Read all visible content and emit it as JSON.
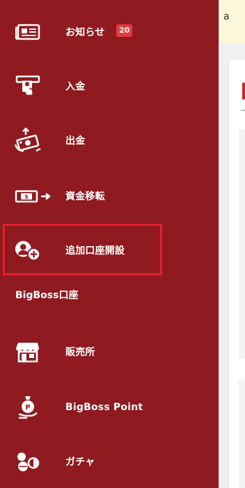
{
  "sidebar": {
    "items": [
      {
        "label": "お知らせ",
        "badge": "20",
        "icon": "newspaper-icon"
      },
      {
        "label": "入金",
        "icon": "atm-deposit-icon"
      },
      {
        "label": "出金",
        "icon": "cash-withdraw-icon"
      },
      {
        "label": "資金移転",
        "icon": "money-transfer-icon"
      },
      {
        "label": "追加口座開設",
        "icon": "add-account-icon"
      }
    ],
    "section_title": "BigBoss口座",
    "section_items": [
      {
        "label": "販売所",
        "icon": "shop-icon"
      },
      {
        "label": "BigBoss Point",
        "icon": "point-bag-icon"
      },
      {
        "label": "ガチャ",
        "icon": "gacha-icon"
      }
    ]
  },
  "notice": {
    "text": "a"
  },
  "colors": {
    "sidebar_bg": "#8f1a1f",
    "highlight": "#e5202c",
    "badge": "#e03c3c"
  }
}
